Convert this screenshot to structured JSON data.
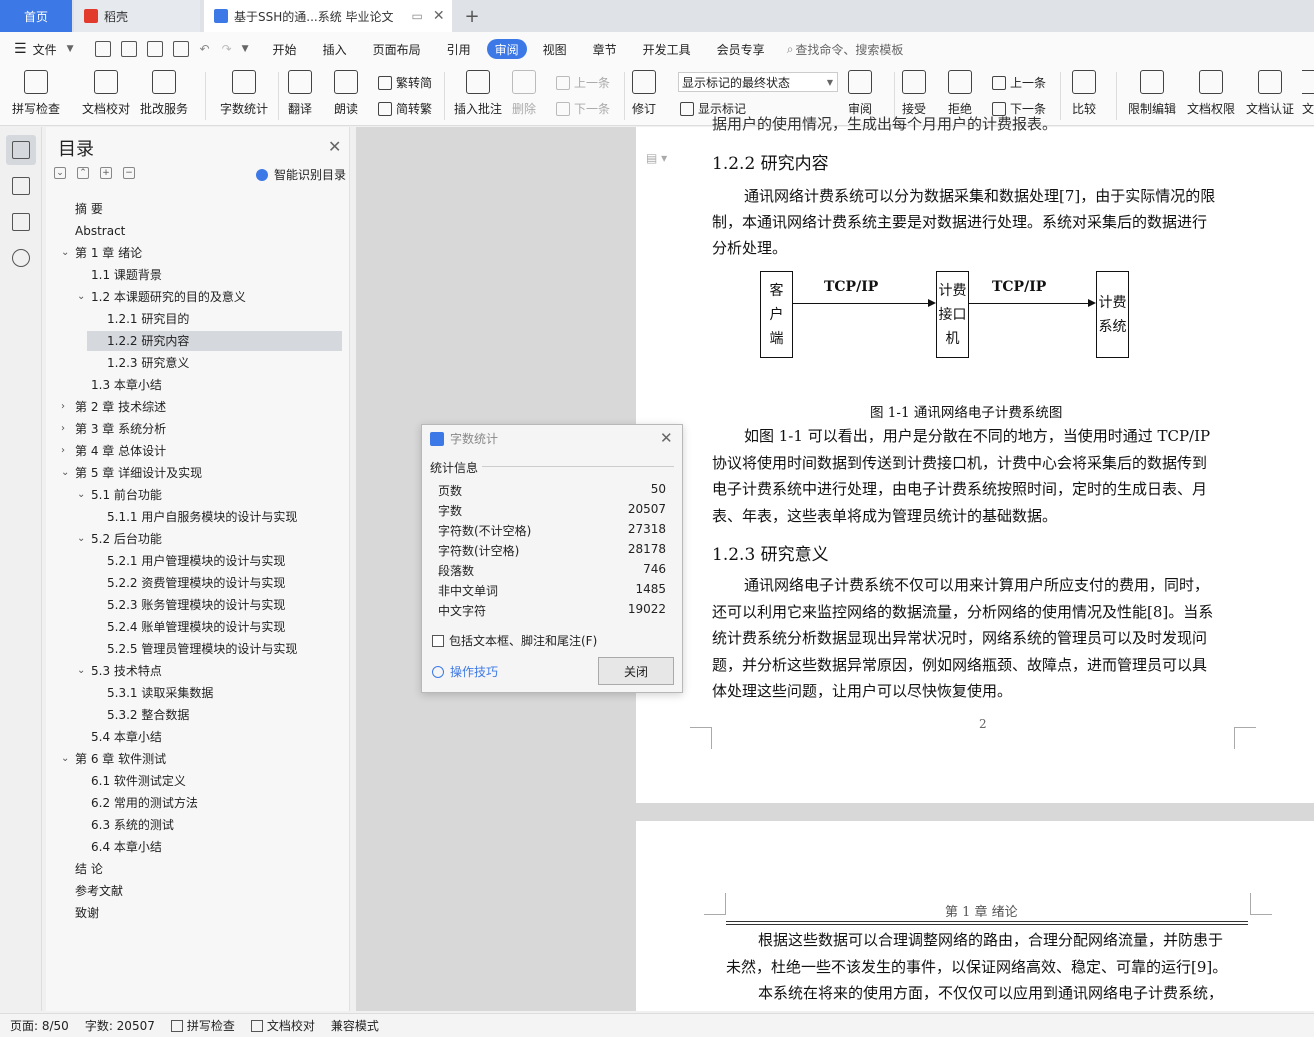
{
  "tabs": {
    "home": "首页",
    "daoke": "稻壳",
    "doc": "基于SSH的通...系统 毕业论文"
  },
  "menu": {
    "file": "文件",
    "items": [
      "开始",
      "插入",
      "页面布局",
      "引用",
      "审阅",
      "视图",
      "章节",
      "开发工具",
      "会员专享"
    ],
    "active": "审阅",
    "search": "查找命令、搜索模板"
  },
  "ribbon": {
    "spell": "拼写检查",
    "proof": "文档校对",
    "batch": "批改服务",
    "count": "字数统计",
    "translate": "翻译",
    "read": "朗读",
    "t2s": "繁转简",
    "s2t": "简转繁",
    "insert_comment": "插入批注",
    "delete": "删除",
    "prev_c": "上一条",
    "next_c": "下一条",
    "revise": "修订",
    "markup_select": "显示标记的最终状态",
    "show_markup": "显示标记",
    "review": "审阅",
    "accept": "接受",
    "reject": "拒绝",
    "prev": "上一条",
    "next": "下一条",
    "compare": "比较",
    "restrict": "限制编辑",
    "permission": "文档权限",
    "cert": "文档认证",
    "enc": "文"
  },
  "toc": {
    "title": "目录",
    "smart": "智能识别目录",
    "items": [
      {
        "t": "摘  要"
      },
      {
        "t": "Abstract"
      },
      {
        "t": "第 1 章   绪论"
      },
      {
        "t": "1.1    课题背景"
      },
      {
        "t": "1.2    本课题研究的目的及意义"
      },
      {
        "t": "1.2.1    研究目的"
      },
      {
        "t": "1.2.2    研究内容"
      },
      {
        "t": "1.2.3    研究意义"
      },
      {
        "t": "1.3    本章小结"
      },
      {
        "t": "第 2 章    技术综述"
      },
      {
        "t": "第 3 章    系统分析"
      },
      {
        "t": "第 4 章    总体设计"
      },
      {
        "t": "第 5 章    详细设计及实现"
      },
      {
        "t": "5.1    前台功能"
      },
      {
        "t": "5.1.1    用户自服务模块的设计与实现"
      },
      {
        "t": "5.2    后台功能"
      },
      {
        "t": "5.2.1    用户管理模块的设计与实现"
      },
      {
        "t": "5.2.2    资费管理模块的设计与实现"
      },
      {
        "t": "5.2.3    账务管理模块的设计与实现"
      },
      {
        "t": "5.2.4    账单管理模块的设计与实现"
      },
      {
        "t": "5.2.5    管理员管理模块的设计与实现"
      },
      {
        "t": "5.3    技术特点"
      },
      {
        "t": "5.3.1    读取采集数据"
      },
      {
        "t": "5.3.2    整合数据"
      },
      {
        "t": "5.4    本章小结"
      },
      {
        "t": "第 6 章    软件测试"
      },
      {
        "t": "6.1    软件测试定义"
      },
      {
        "t": "6.2    常用的测试方法"
      },
      {
        "t": "6.3    系统的测试"
      },
      {
        "t": "6.4    本章小结"
      },
      {
        "t": "结  论"
      },
      {
        "t": "参考文献"
      },
      {
        "t": "致谢"
      }
    ]
  },
  "page1": {
    "top_partial": "据用户的使用情况，生成出每个月用户的计费报表。",
    "h1": "1.2.2    研究内容",
    "p1": [
      "通讯网络计费系统可以分为数据采集和数据处理[7]，由于实际情况的限",
      "制，本通讯网络计费系统主要是对数据进行处理。系统对采集后的数据进行",
      "分析处理。"
    ],
    "fig": {
      "client": [
        "客",
        "户",
        "端"
      ],
      "iface": [
        "计费",
        "接口",
        "机"
      ],
      "sys": [
        "计费",
        "系统"
      ],
      "proto1": "TCP/IP",
      "proto2": "TCP/IP",
      "caption": "图 1-1   通讯网络电子计费系统图"
    },
    "p2": [
      "如图 1-1 可以看出，用户是分散在不同的地方，当使用时通过 TCP/IP",
      "协议将使用时间数据到传送到计费接口机，计费中心会将采集后的数据传到",
      "电子计费系统中进行处理，由电子计费系统按照时间，定时的生成日表、月",
      "表、年表，这些表单将成为管理员统计的基础数据。"
    ],
    "h2": "1.2.3    研究意义",
    "p3": [
      "通讯网络电子计费系统不仅可以用来计算用户所应支付的费用，同时，",
      "还可以利用它来监控网络的数据流量，分析网络的使用情况及性能[8]。当系",
      "统计费系统分析数据显现出异常状况时，网络系统的管理员可以及时发现问",
      "题，并分析这些数据异常原因，例如网络瓶颈、故障点，进而管理员可以具",
      "体处理这些问题，让用户可以尽快恢复使用。"
    ],
    "page_num": "2"
  },
  "page2": {
    "header": "第 1 章    绪论",
    "p": [
      "根据这些数据可以合理调整网络的路由，合理分配网络流量，并防患于",
      "未然，杜绝一些不该发生的事件，以保证网络高效、稳定、可靠的运行[9]。",
      "本系统在将来的使用方面，不仅仅可以应用到通讯网络电子计费系统，"
    ]
  },
  "dialog": {
    "title": "字数统计",
    "section": "统计信息",
    "rows": [
      {
        "k": "页数",
        "v": "50"
      },
      {
        "k": "字数",
        "v": "20507"
      },
      {
        "k": "字符数(不计空格)",
        "v": "27318"
      },
      {
        "k": "字符数(计空格)",
        "v": "28178"
      },
      {
        "k": "段落数",
        "v": "746"
      },
      {
        "k": "非中文单词",
        "v": "1485"
      },
      {
        "k": "中文字符",
        "v": "19022"
      }
    ],
    "checkbox": "包括文本框、脚注和尾注(F)",
    "tips": "操作技巧",
    "close": "关闭"
  },
  "status": {
    "page": "页面: 8/50",
    "words": "字数: 20507",
    "spell": "拼写检查",
    "proof": "文档校对",
    "compat": "兼容模式"
  }
}
